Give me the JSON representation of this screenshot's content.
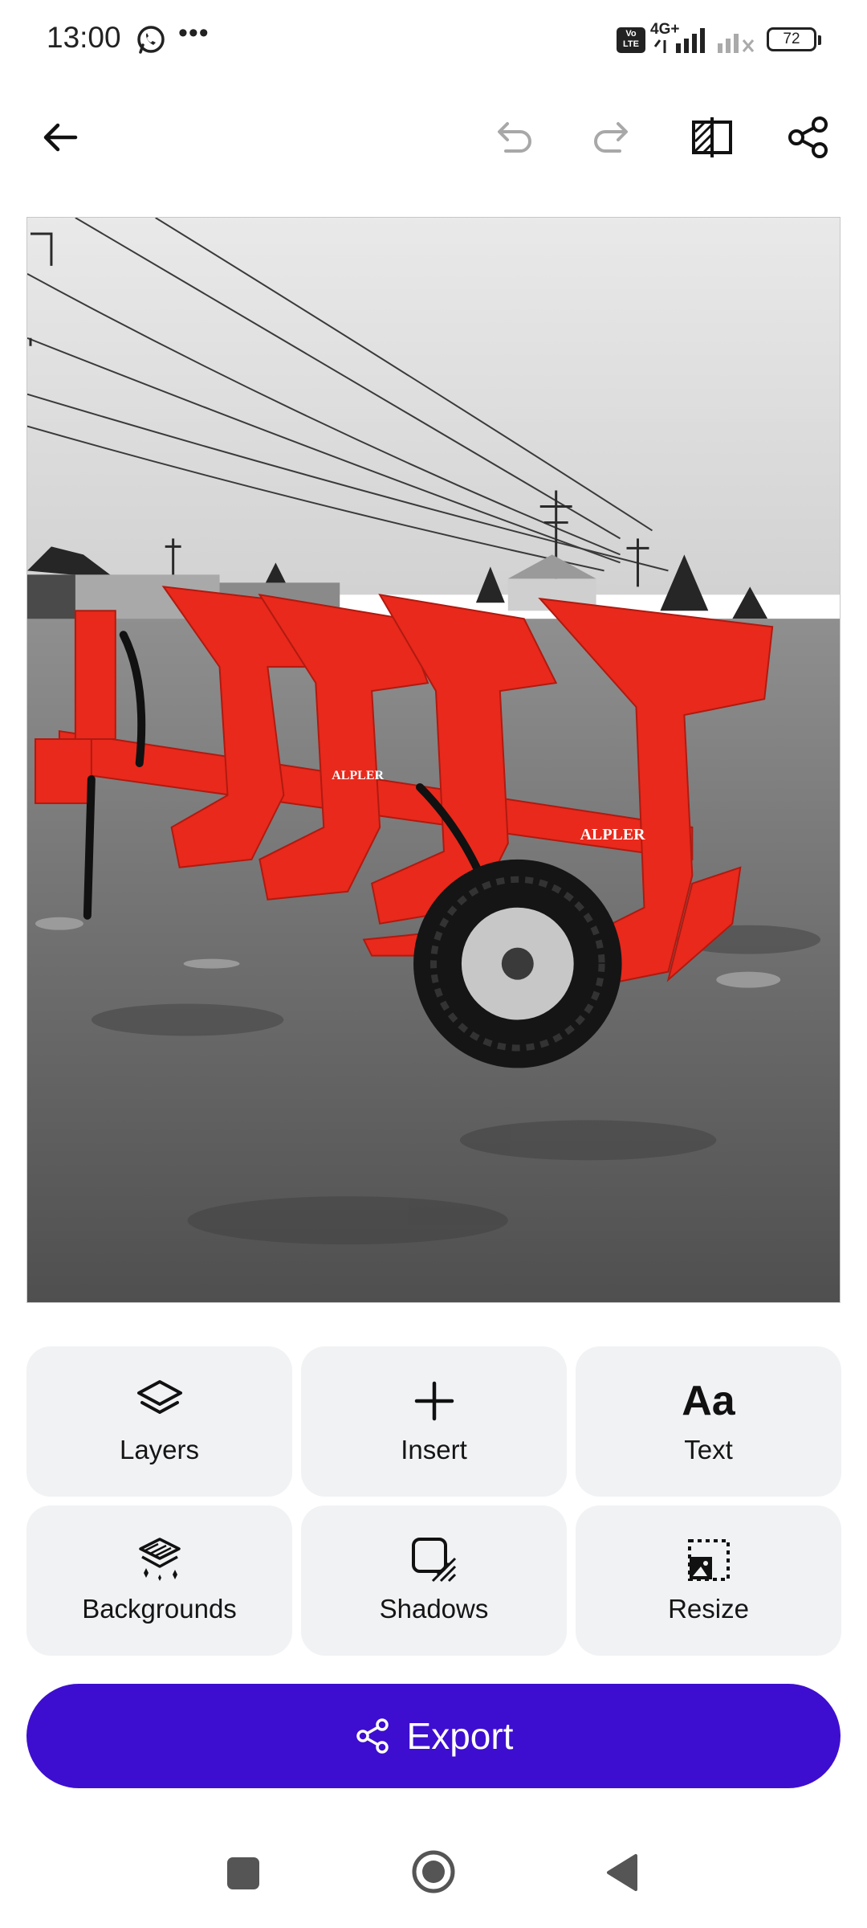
{
  "status_bar": {
    "time": "13:00",
    "dots": "•••",
    "volte": "Vo LTE",
    "network": "4G+",
    "battery": "72",
    "icons": [
      "whatsapp-icon",
      "signal-icon",
      "signal-no-service-icon",
      "battery-icon"
    ]
  },
  "toolbar": {
    "icons": [
      "back-arrow-icon",
      "undo-icon",
      "redo-icon",
      "compare-icon",
      "share-icon"
    ]
  },
  "canvas": {
    "brand_text_1": "ALPLER",
    "brand_text_2": "ALPLER"
  },
  "tools": [
    {
      "label": "Layers",
      "icon": "layers-icon"
    },
    {
      "label": "Insert",
      "icon": "plus-icon"
    },
    {
      "label": "Text",
      "icon_text": "Aa",
      "icon": "text-icon"
    },
    {
      "label": "Backgrounds",
      "icon": "backgrounds-icon"
    },
    {
      "label": "Shadows",
      "icon": "shadows-icon"
    },
    {
      "label": "Resize",
      "icon": "resize-icon"
    }
  ],
  "export": {
    "label": "Export",
    "icon": "share-icon"
  },
  "nav": {
    "icons": [
      "recents-square-icon",
      "home-circle-icon",
      "back-triangle-icon"
    ]
  },
  "colors": {
    "accent": "#3d0ed0",
    "tile_bg": "#f1f2f4",
    "plough_red": "#e8291c"
  }
}
